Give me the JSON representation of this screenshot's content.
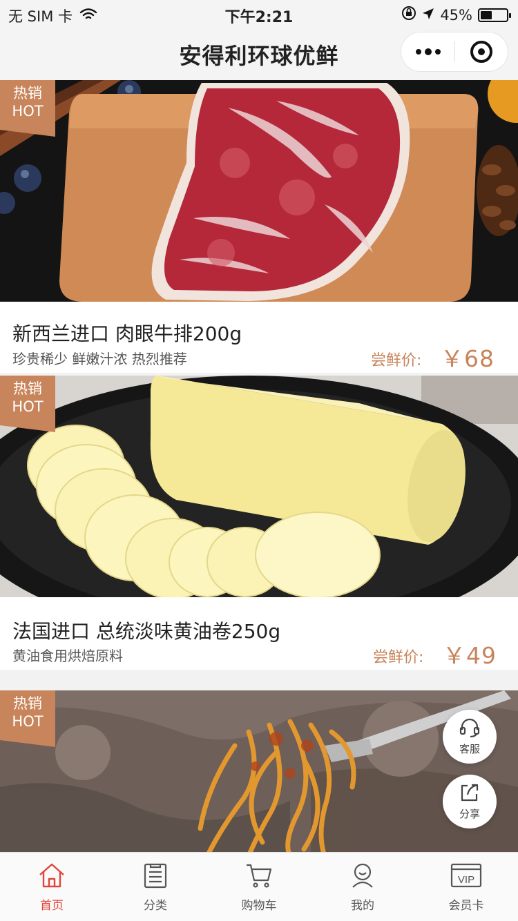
{
  "status_bar": {
    "carrier": "无 SIM 卡",
    "time": "下午2:21",
    "battery": "45%",
    "battery_level": 0.45
  },
  "nav": {
    "title": "安得利环球优鲜"
  },
  "products": [
    {
      "badge_line1": "热销",
      "badge_line2": "HOT",
      "name": "新西兰进口 肉眼牛排200g",
      "desc": "珍贵稀少 鲜嫩汁浓 热烈推荐",
      "price_label": "尝鲜价:",
      "price": "￥68"
    },
    {
      "badge_line1": "热销",
      "badge_line2": "HOT",
      "name": "法国进口 总统淡味黄油卷250g",
      "desc": "黄油食用烘焙原料",
      "price_label": "尝鲜价:",
      "price": "￥49"
    },
    {
      "badge_line1": "热销",
      "badge_line2": "HOT"
    }
  ],
  "floating": {
    "service_label": "客服",
    "share_label": "分享"
  },
  "tabbar": {
    "items": [
      {
        "label": "首页",
        "icon": "home-icon",
        "active": true
      },
      {
        "label": "分类",
        "icon": "category-icon",
        "active": false
      },
      {
        "label": "购物车",
        "icon": "cart-icon",
        "active": false
      },
      {
        "label": "我的",
        "icon": "profile-icon",
        "active": false
      },
      {
        "label": "会员卡",
        "icon": "vip-card-icon",
        "active": false
      }
    ]
  },
  "colors": {
    "accent": "#c8845a",
    "active_tab": "#e0453a"
  }
}
